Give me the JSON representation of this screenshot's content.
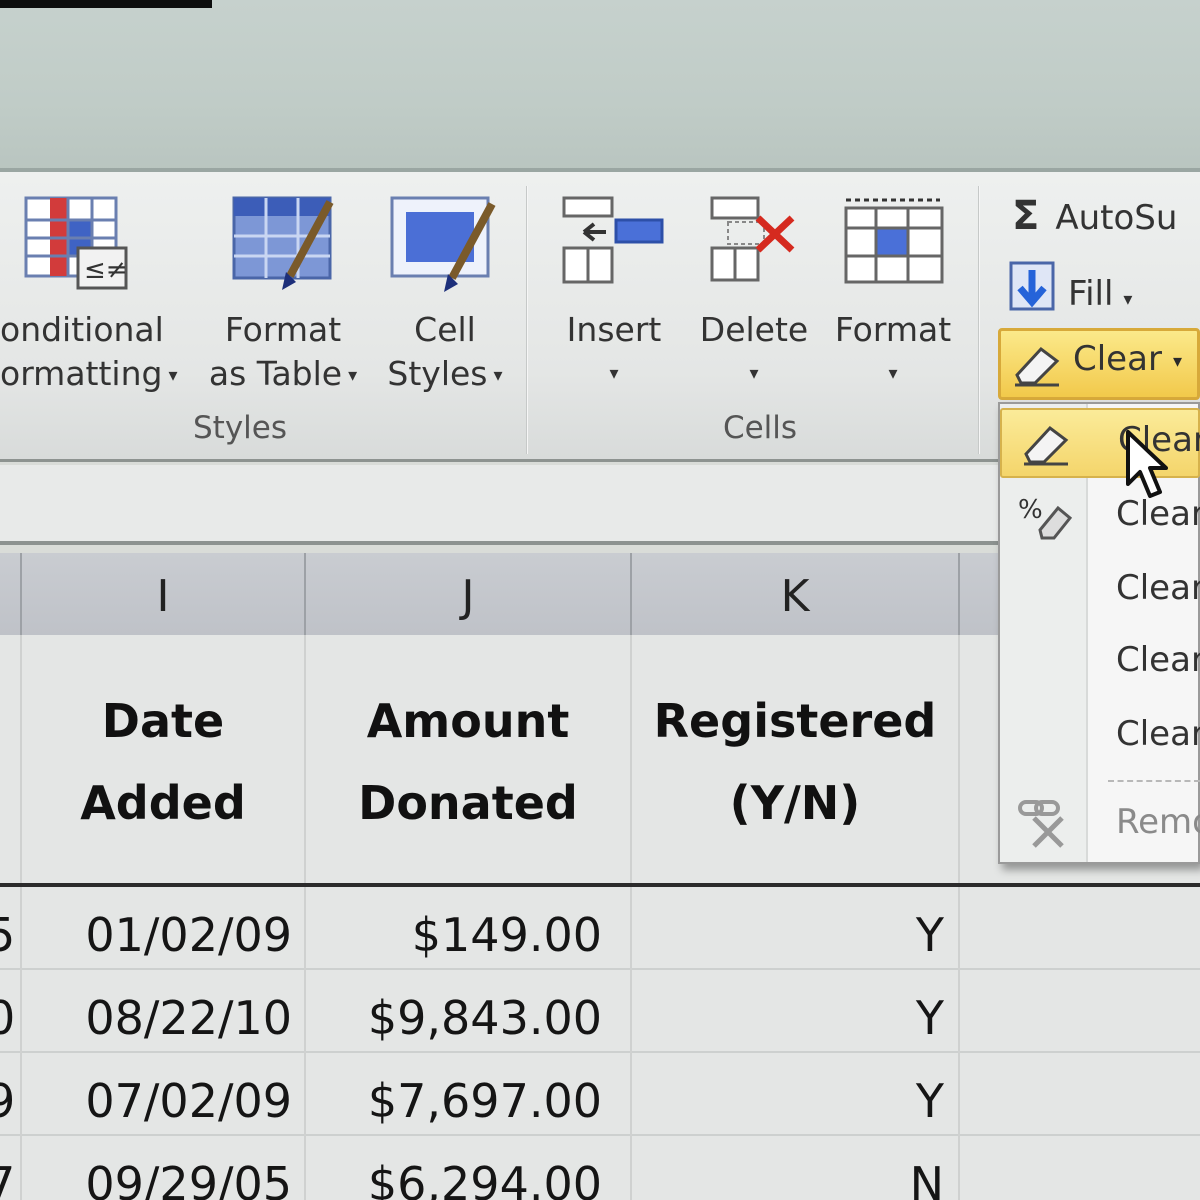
{
  "ribbon": {
    "styles_group": {
      "label": "Styles",
      "conditional_formatting": {
        "line1": "onditional",
        "line2": "ormatting"
      },
      "format_as_table": {
        "line1": "Format",
        "line2": "as Table"
      },
      "cell_styles": {
        "line1": "Cell",
        "line2": "Styles"
      }
    },
    "cells_group": {
      "label": "Cells",
      "insert": "Insert",
      "delete": "Delete",
      "format": "Format"
    },
    "editing_group": {
      "autosum": "AutoSu",
      "fill": "Fill",
      "clear": "Clear"
    }
  },
  "clear_menu": {
    "items": [
      {
        "label": "Clear"
      },
      {
        "label": "Clear"
      },
      {
        "label": "Clear"
      },
      {
        "label": "Clear"
      },
      {
        "label": "Clear"
      },
      {
        "label": "Remo"
      }
    ]
  },
  "sheet": {
    "columns": [
      "I",
      "J",
      "K"
    ],
    "headers": {
      "date": {
        "line1": "Date",
        "line2": "Added"
      },
      "amount": {
        "line1": "Amount",
        "line2": "Donated"
      },
      "registered": {
        "line1": "Registered",
        "line2": "(Y/N)"
      }
    },
    "rows": [
      {
        "prev": "5",
        "date": "01/02/09",
        "amount": "$149.00",
        "registered": "Y"
      },
      {
        "prev": "0",
        "date": "08/22/10",
        "amount": "$9,843.00",
        "registered": "Y"
      },
      {
        "prev": "9",
        "date": "07/02/09",
        "amount": "$7,697.00",
        "registered": "Y"
      },
      {
        "prev": "7",
        "date": "09/29/05",
        "amount": "$6,294.00",
        "registered": "N"
      }
    ]
  },
  "colors": {
    "highlight": "#f4d56b",
    "ribbon_bg": "#e8eae9",
    "column_header": "#c4c7cc"
  }
}
